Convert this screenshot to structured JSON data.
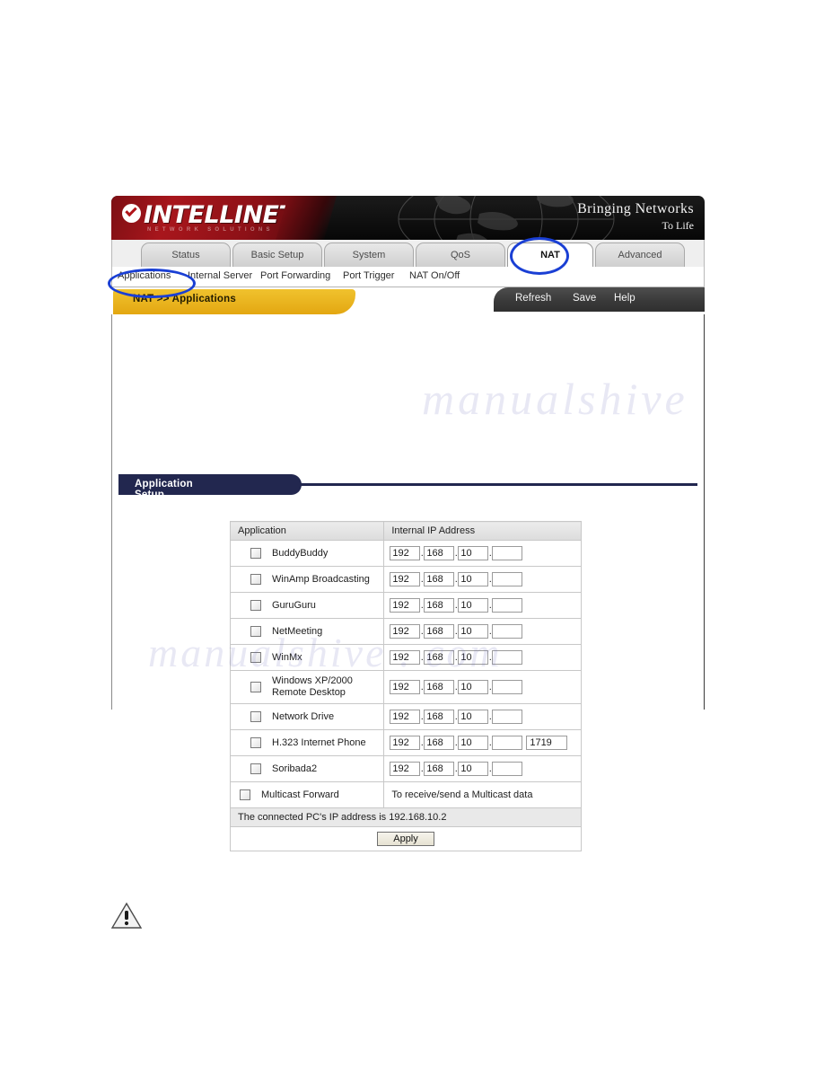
{
  "branding": {
    "logo_word": "INTELLINET",
    "logo_sub": "NETWORK SOLUTIONS",
    "tagline_line1": "Bringing Networks",
    "tagline_line2": "To Life",
    "accent_red": "#a8161c",
    "accent_yellow": "#e8b21d",
    "accent_navy": "#22274f",
    "annotation_blue": "#1a3fd4"
  },
  "tabs": [
    {
      "label": "Status",
      "active": false
    },
    {
      "label": "Basic Setup",
      "active": false
    },
    {
      "label": "System",
      "active": false
    },
    {
      "label": "QoS",
      "active": false
    },
    {
      "label": "NAT",
      "active": true
    },
    {
      "label": "Advanced",
      "active": false
    }
  ],
  "submenu": [
    {
      "label": "Applications",
      "selected": true
    },
    {
      "label": "Internal Server",
      "selected": false
    },
    {
      "label": "Port Forwarding",
      "selected": false
    },
    {
      "label": "Port Trigger",
      "selected": false
    },
    {
      "label": "NAT On/Off",
      "selected": false
    }
  ],
  "breadcrumb": "NAT >> Applications",
  "toolbar": [
    {
      "label": "Refresh"
    },
    {
      "label": "Save"
    },
    {
      "label": "Help"
    }
  ],
  "section": {
    "title": "Application Setup"
  },
  "table": {
    "headers": [
      "Application",
      "Internal IP Address"
    ],
    "rows": [
      {
        "name": "BuddyBuddy",
        "checked": false,
        "octets": [
          "192",
          "168",
          "10",
          ""
        ],
        "port": null
      },
      {
        "name": "WinAmp Broadcasting",
        "checked": false,
        "octets": [
          "192",
          "168",
          "10",
          ""
        ],
        "port": null
      },
      {
        "name": "GuruGuru",
        "checked": false,
        "octets": [
          "192",
          "168",
          "10",
          ""
        ],
        "port": null
      },
      {
        "name": "NetMeeting",
        "checked": false,
        "octets": [
          "192",
          "168",
          "10",
          ""
        ],
        "port": null
      },
      {
        "name": "WinMx",
        "checked": false,
        "octets": [
          "192",
          "168",
          "10",
          ""
        ],
        "port": null
      },
      {
        "name": "Windows XP/2000 Remote Desktop",
        "name_line1": "Windows XP/2000",
        "name_line2": "Remote Desktop",
        "checked": false,
        "octets": [
          "192",
          "168",
          "10",
          ""
        ],
        "port": null
      },
      {
        "name": "Network Drive",
        "checked": false,
        "octets": [
          "192",
          "168",
          "10",
          ""
        ],
        "port": null
      },
      {
        "name": "H.323 Internet Phone",
        "checked": false,
        "octets": [
          "192",
          "168",
          "10",
          ""
        ],
        "port": "1719"
      },
      {
        "name": "Soribada2",
        "checked": false,
        "octets": [
          "192",
          "168",
          "10",
          ""
        ],
        "port": null
      }
    ],
    "multicast_row": {
      "name": "Multicast Forward",
      "checked": false,
      "note": "To receive/send a Multicast data"
    },
    "status_note": "The connected PC's IP address is 192.168.10.2",
    "apply_label": "Apply"
  },
  "watermark": {
    "line1": "manualshive . com",
    "line2": "manualshive"
  },
  "footer": {
    "warning_icon": "warning-triangle-icon"
  }
}
